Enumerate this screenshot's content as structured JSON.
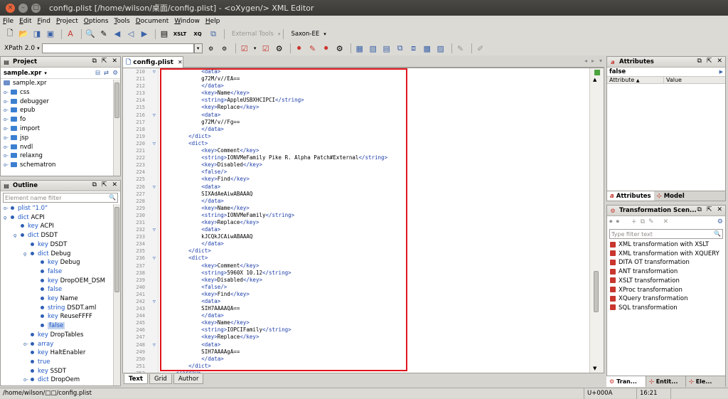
{
  "window": {
    "title": "config.plist [/home/wilson/桌面/config.plist] - <oXygen/> XML Editor"
  },
  "menu": [
    "File",
    "Edit",
    "Find",
    "Project",
    "Options",
    "Tools",
    "Document",
    "Window",
    "Help"
  ],
  "toolbar": {
    "external_tools": "External Tools",
    "transformer": "Saxon-EE"
  },
  "xpath": {
    "label": "XPath 2.0",
    "value": ""
  },
  "project": {
    "title": "Project",
    "file": "sample.xpr",
    "items": [
      "sample.xpr",
      "css",
      "debugger",
      "epub",
      "fo",
      "import",
      "jsp",
      "nvdl",
      "relaxng",
      "schematron"
    ]
  },
  "outline": {
    "title": "Outline",
    "filter_placeholder": "Element name filter",
    "rows": [
      {
        "name": "plist",
        "value": "\"1.0\""
      },
      {
        "name": "dict",
        "value": "ACPI"
      },
      {
        "name": "key",
        "value": "ACPI"
      },
      {
        "name": "dict",
        "value": "DSDT"
      },
      {
        "name": "key",
        "value": "DSDT"
      },
      {
        "name": "dict",
        "value": "Debug"
      },
      {
        "name": "key",
        "value": "Debug"
      },
      {
        "name": "false",
        "value": ""
      },
      {
        "name": "key",
        "value": "DropOEM_DSM"
      },
      {
        "name": "false",
        "value": ""
      },
      {
        "name": "key",
        "value": "Name"
      },
      {
        "name": "string",
        "value": "DSDT.aml"
      },
      {
        "name": "key",
        "value": "ReuseFFFF"
      },
      {
        "name": "false",
        "value": ""
      },
      {
        "name": "key",
        "value": "DropTables"
      },
      {
        "name": "array",
        "value": ""
      },
      {
        "name": "key",
        "value": "HaltEnabler"
      },
      {
        "name": "true",
        "value": ""
      },
      {
        "name": "key",
        "value": "SSDT"
      },
      {
        "name": "dict",
        "value": "DropOem"
      }
    ]
  },
  "editor": {
    "tab": "config.plist",
    "bottom_tabs": [
      "Text",
      "Grid",
      "Author"
    ],
    "lines": [
      {
        "n": "210",
        "t": "            <data>"
      },
      {
        "n": "211",
        "t": "            g72M/v//EA=="
      },
      {
        "n": "212",
        "t": "            </data>"
      },
      {
        "n": "213",
        "t": "            <key>Name</key>"
      },
      {
        "n": "214",
        "t": "            <string>AppleUSBXHCIPCI</string>"
      },
      {
        "n": "215",
        "t": "            <key>Replace</key>"
      },
      {
        "n": "216",
        "t": "            <data>"
      },
      {
        "n": "217",
        "t": "            g72M/v//Fg=="
      },
      {
        "n": "218",
        "t": "            </data>"
      },
      {
        "n": "219",
        "t": "        </dict>"
      },
      {
        "n": "220",
        "t": "        <dict>"
      },
      {
        "n": "221",
        "t": "            <key>Comment</key>"
      },
      {
        "n": "222",
        "t": "            <string>IONVMeFamily Pike R. Alpha Patch#External</string>"
      },
      {
        "n": "223",
        "t": "            <key>Disabled</key>"
      },
      {
        "n": "224",
        "t": "            <false/>"
      },
      {
        "n": "225",
        "t": "            <key>Find</key>"
      },
      {
        "n": "226",
        "t": "            <data>"
      },
      {
        "n": "227",
        "t": "            SIXAdAeAiwABAAAQ"
      },
      {
        "n": "228",
        "t": "            </data>"
      },
      {
        "n": "229",
        "t": "            <key>Name</key>"
      },
      {
        "n": "230",
        "t": "            <string>IONVMeFamily</string>"
      },
      {
        "n": "231",
        "t": "            <key>Replace</key>"
      },
      {
        "n": "232",
        "t": "            <data>"
      },
      {
        "n": "233",
        "t": "            kJCQkJCAiwABAAAQ"
      },
      {
        "n": "234",
        "t": "            </data>"
      },
      {
        "n": "235",
        "t": "        </dict>"
      },
      {
        "n": "236",
        "t": "        <dict>"
      },
      {
        "n": "237",
        "t": "            <key>Comment</key>"
      },
      {
        "n": "238",
        "t": "            <string>5960X 10.12</string>"
      },
      {
        "n": "239",
        "t": "            <key>Disabled</key>"
      },
      {
        "n": "240",
        "t": "            <false/>"
      },
      {
        "n": "241",
        "t": "            <key>Find</key>"
      },
      {
        "n": "242",
        "t": "            <data>"
      },
      {
        "n": "243",
        "t": "            SIH7AAAAQA=="
      },
      {
        "n": "244",
        "t": "            </data>"
      },
      {
        "n": "245",
        "t": "            <key>Name</key>"
      },
      {
        "n": "246",
        "t": "            <string>IOPCIFamily</string>"
      },
      {
        "n": "247",
        "t": "            <key>Replace</key>"
      },
      {
        "n": "248",
        "t": "            <data>"
      },
      {
        "n": "249",
        "t": "            SIH7AAAAgA=="
      },
      {
        "n": "250",
        "t": "            </data>"
      },
      {
        "n": "251",
        "t": "        </dict>"
      },
      {
        "n": "252",
        "t": "    </array>"
      }
    ]
  },
  "attributes": {
    "title": "Attributes",
    "value_row": "false",
    "col_attribute": "Attribute",
    "col_value": "Value",
    "tab_attributes": "Attributes",
    "tab_model": "Model"
  },
  "transformation": {
    "title": "Transformation Scen...",
    "filter_placeholder": "Type filter text",
    "items": [
      "XML transformation with XSLT",
      "XML transformation with XQUERY",
      "DITA OT transformation",
      "ANT transformation",
      "XSLT transformation",
      "XProc transformation",
      "XQuery transformation",
      "SQL transformation"
    ],
    "bottom_tabs": [
      "Tran...",
      "Entit...",
      "Ele..."
    ]
  },
  "status": {
    "path": "/home/wilson/□□/config.plist",
    "unicode": "U+000A",
    "position": "16:21"
  }
}
